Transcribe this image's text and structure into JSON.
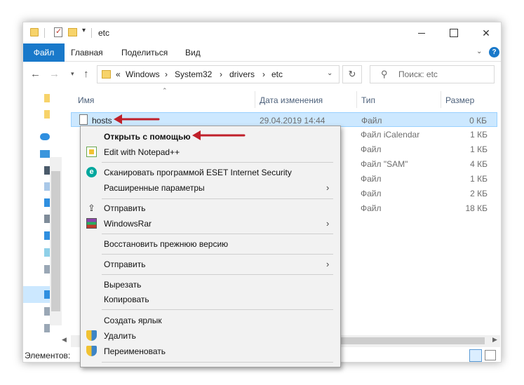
{
  "window": {
    "title": "etc",
    "controls": {
      "close": "✕"
    }
  },
  "ribbon": {
    "tabs": [
      "Файл",
      "Главная",
      "Поделиться",
      "Вид"
    ],
    "help": "?"
  },
  "address": {
    "prefix": "«",
    "crumbs": [
      "Windows",
      "System32",
      "drivers",
      "etc"
    ],
    "separator": "›",
    "search_placeholder": "Поиск: etc"
  },
  "columns": {
    "name": "Имя",
    "date": "Дата изменения",
    "type": "Тип",
    "size": "Размер"
  },
  "files": [
    {
      "name": "hosts",
      "date": "29.04.2019 14:44",
      "type": "Файл",
      "size": "0 КБ",
      "selected": true
    },
    {
      "name": "",
      "date": "",
      "type": "Файл iCalendar",
      "size": "1 КБ"
    },
    {
      "name": "",
      "date": "",
      "type": "Файл",
      "size": "1 КБ"
    },
    {
      "name": "",
      "date": "",
      "type": "Файл \"SAM\"",
      "size": "4 КБ"
    },
    {
      "name": "",
      "date": "",
      "type": "Файл",
      "size": "1 КБ"
    },
    {
      "name": "",
      "date": "",
      "type": "Файл",
      "size": "2 КБ"
    },
    {
      "name": "",
      "date": "",
      "type": "Файл",
      "size": "18 КБ"
    }
  ],
  "status": {
    "items_label": "Элементов:"
  },
  "context_menu": {
    "items": [
      {
        "label": "Открыть с помощью",
        "bold": true
      },
      {
        "label": "Edit with Notepad++",
        "icon": "notepad-plus-icon"
      },
      {
        "label": "Сканировать программой ESET Internet Security",
        "icon": "eset-icon"
      },
      {
        "label": "Расширенные параметры",
        "submenu": true
      },
      {
        "label": "Отправить",
        "icon": "share-icon"
      },
      {
        "label": "WindowsRar",
        "icon": "winrar-icon",
        "submenu": true
      },
      {
        "label": "Восстановить прежнюю версию"
      },
      {
        "label": "Отправить",
        "submenu": true
      },
      {
        "label": "Вырезать"
      },
      {
        "label": "Копировать"
      },
      {
        "label": "Создать ярлык"
      },
      {
        "label": "Удалить",
        "icon": "shield-icon"
      },
      {
        "label": "Переименовать",
        "icon": "shield-icon"
      }
    ]
  },
  "colors": {
    "accent": "#1979ca",
    "selection": "#cce8ff",
    "annotation": "#c0202a"
  }
}
